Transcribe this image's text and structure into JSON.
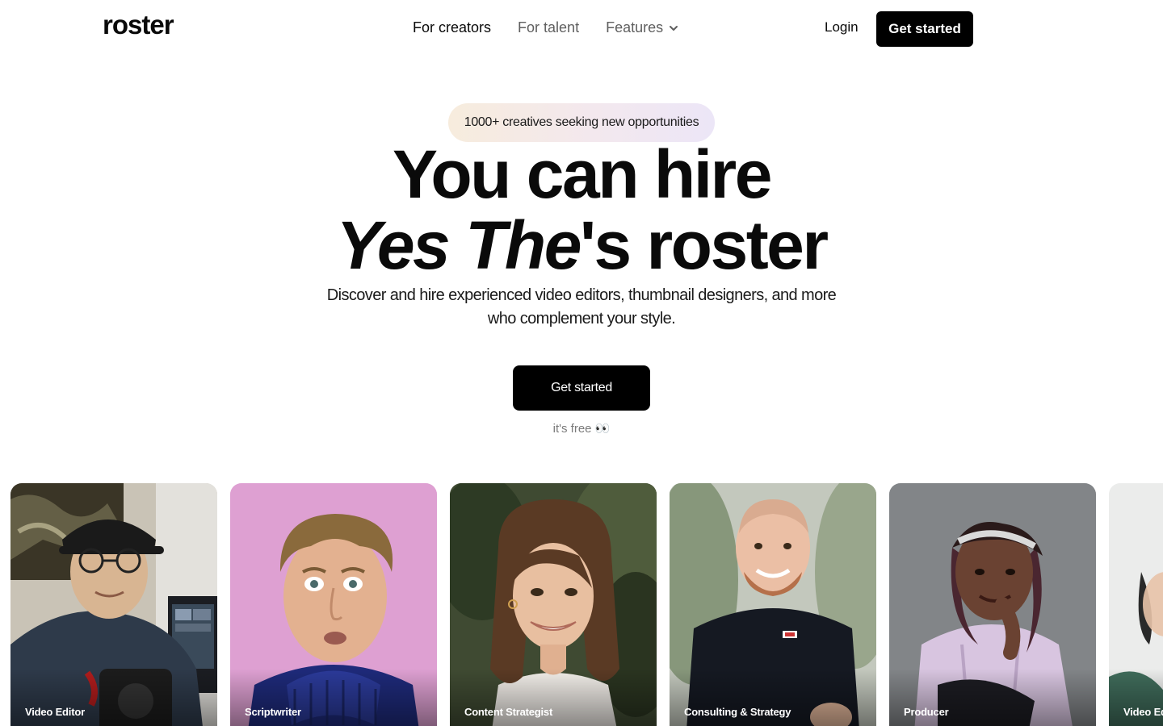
{
  "nav": {
    "logo": "roster",
    "links": [
      {
        "label": "For creators",
        "active": true
      },
      {
        "label": "For talent",
        "active": false
      },
      {
        "label": "Features",
        "active": false,
        "icon": "chevron-down-icon"
      }
    ],
    "login_label": "Login",
    "cta_label": "Get started"
  },
  "hero": {
    "badge": "1000+ creatives seeking new opportunities",
    "headline_line1": "You can hire",
    "headline_name": "Yes The",
    "headline_suffix": "'s roster",
    "subtitle": "Discover and hire experienced video editors, thumbnail designers, and more who complement your style.",
    "cta_label": "Get started",
    "note": "it's free 👀"
  },
  "cards": [
    {
      "role": "Video Editor"
    },
    {
      "role": "Scriptwriter"
    },
    {
      "role": "Content Strategist"
    },
    {
      "role": "Consulting & Strategy"
    },
    {
      "role": "Producer"
    },
    {
      "role": "Video Editor"
    }
  ],
  "colors": {
    "primary": "#000000",
    "text": "#0a0a0a",
    "muted": "#5f5f5f",
    "badge_gradient_start": "#f7ecdd",
    "badge_gradient_end": "#ece6f7"
  }
}
